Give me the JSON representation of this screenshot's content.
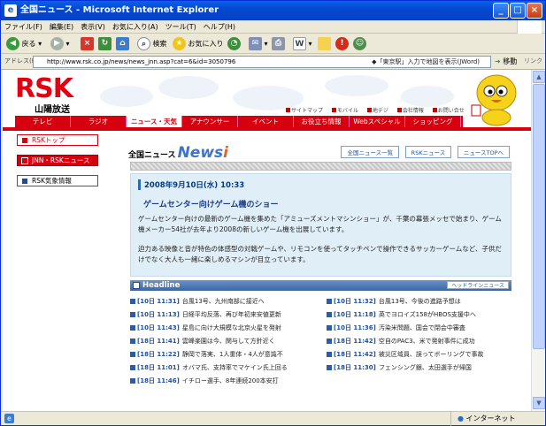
{
  "window": {
    "title": "全国ニュース - Microsoft Internet Explorer",
    "min": "_",
    "max": "□",
    "close": "×"
  },
  "menu": [
    "ファイル(F)",
    "編集(E)",
    "表示(V)",
    "お気に入り(A)",
    "ツール(T)",
    "ヘルプ(H)"
  ],
  "toolbar": {
    "back": "戻る",
    "search": "検索",
    "favorites": "お気に入り"
  },
  "address": {
    "label": "アドレス(D)",
    "url": "http://www.rsk.co.jp/news/news_jnn.asp?cat=6&id=3050796",
    "hint": "◆「東京駅」入力で地図を表示(JWord)",
    "go": "移動",
    "links": "リンク"
  },
  "status": {
    "zone": "インターネット"
  },
  "site": {
    "logo": "RSK",
    "logo_sub": "山陽放送",
    "toplinks": [
      "サイトマップ",
      "モバイル",
      "地デジ",
      "会社情報",
      "お問い合せ"
    ],
    "nav": [
      "テレビ",
      "ラジオ",
      "ニュース・天気",
      "アナウンサー",
      "イベント",
      "お役立ち情報",
      "Webスペシャル",
      "ショッピング"
    ],
    "nav_active_index": 2
  },
  "sidebar": {
    "items": [
      "RSKトップ",
      "JNN・RSKニュース",
      "RSK気象情報"
    ]
  },
  "main": {
    "title_prefix": "全国ニュース",
    "title_logo": "News",
    "title_logo_i": "i",
    "buttons": [
      "全国ニュース一覧",
      "RSKニュース",
      "ニュースTOPへ"
    ],
    "article": {
      "date": "2008年9月10日(水) 10:33",
      "headline": "ゲームセンター向けゲーム機のショー",
      "para1": "ゲームセンター向けの最新のゲーム機を集めた「アミューズメントマシンショー」が、千葉の幕張メッセで始まり、ゲーム機メーカー54社が去年より2008の新しいゲーム機を出展しています。",
      "para2": "迫力ある映像と音が特色の体感型の対戦ゲームや、リモコンを使ってタッチペンで操作できるサッカーゲームなど、子供だけでなく大人も一緒に楽しめるマシンが目立っています。"
    },
    "headline_label": "Headline",
    "headline_list_btn": "ヘッドラインニュース",
    "headlines_left": [
      {
        "time": "[10日 11:31]",
        "text": "台風13号、九州南部に接近へ"
      },
      {
        "time": "[10日 11:13]",
        "text": "日経平均反落、再び年初来安値更新"
      },
      {
        "time": "[10日 11:43]",
        "text": "星島に向け大規模な北京火星を発射"
      },
      {
        "time": "[18日 11:41]",
        "text": "雲峰楽園は今、関与して方針近く"
      },
      {
        "time": "[18日 11:22]",
        "text": "静岡で落実、1人重体・4人が意識不"
      },
      {
        "time": "[18日 11:01]",
        "text": "オバマ氏、支持率でマケイン氏上回る"
      },
      {
        "time": "[18日 11:46]",
        "text": "イチロー選手、8年連続200本安打"
      }
    ],
    "headlines_right": [
      {
        "time": "[10日 11:32]",
        "text": "台風13号、今後の進路予想は"
      },
      {
        "time": "[10日 11:18]",
        "text": "英でヨロイズ158がHBOS支援中へ"
      },
      {
        "time": "[10日 11:36]",
        "text": "汚染米問題、国会で閉会中審査"
      },
      {
        "time": "[18日 11:42]",
        "text": "空自のPAC3、米で発射事件に成功"
      },
      {
        "time": "[18日 11:42]",
        "text": "被災区域員、誤ってボーリングで事故"
      },
      {
        "time": "[18日 11:30]",
        "text": "フェンシング銀、太田選手が帰国"
      }
    ]
  }
}
